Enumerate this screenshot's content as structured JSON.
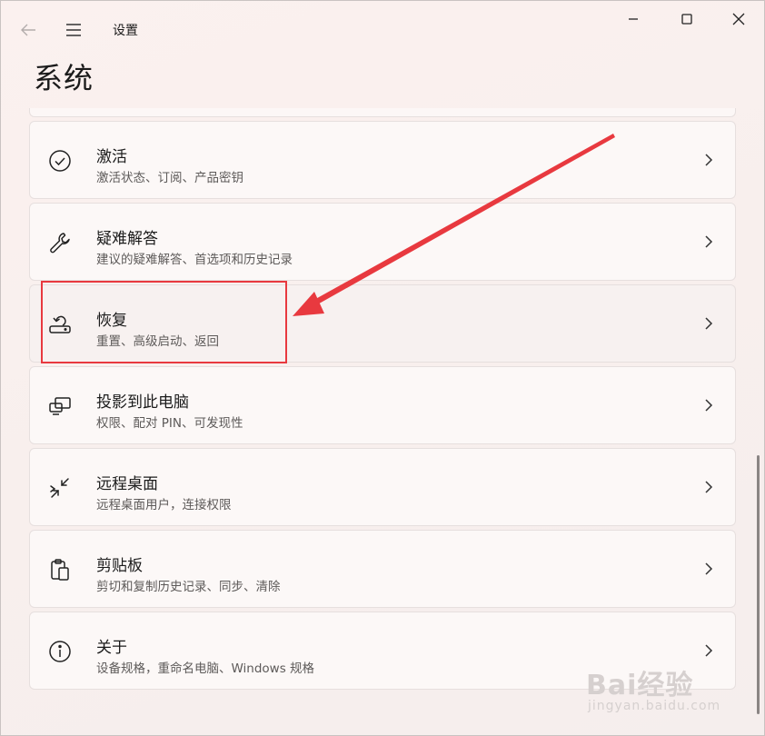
{
  "window": {
    "title": "设置",
    "controls": {
      "minimize_icon": "minimize-icon",
      "maximize_icon": "maximize-icon",
      "close_icon": "close-icon"
    }
  },
  "page": {
    "title": "系统"
  },
  "items": [
    {
      "icon": "check-circle-icon",
      "title": "激活",
      "subtitle": "激活状态、订阅、产品密钥"
    },
    {
      "icon": "wrench-icon",
      "title": "疑难解答",
      "subtitle": "建议的疑难解答、首选项和历史记录"
    },
    {
      "icon": "recovery-icon",
      "title": "恢复",
      "subtitle": "重置、高级启动、返回",
      "highlighted": true
    },
    {
      "icon": "project-icon",
      "title": "投影到此电脑",
      "subtitle": "权限、配对 PIN、可发现性"
    },
    {
      "icon": "remote-desktop-icon",
      "title": "远程桌面",
      "subtitle": "远程桌面用户，连接权限"
    },
    {
      "icon": "clipboard-icon",
      "title": "剪贴板",
      "subtitle": "剪切和复制历史记录、同步、清除"
    },
    {
      "icon": "info-icon",
      "title": "关于",
      "subtitle": "设备规格，重命名电脑、Windows 规格"
    }
  ],
  "annotation": {
    "box_color": "#e8393f",
    "arrow_color": "#e8393f"
  },
  "watermark": {
    "brand": "Bai经验",
    "url": "jingyan.baidu.com"
  }
}
